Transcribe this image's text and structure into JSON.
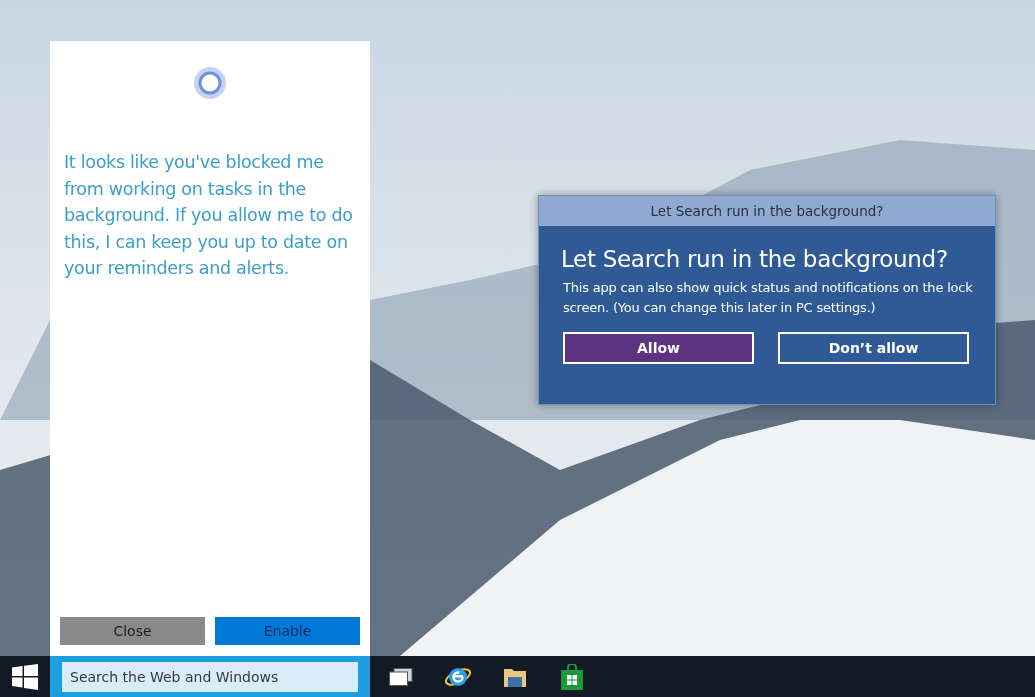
{
  "cortana": {
    "message": "It looks like you've blocked me from working on tasks in the background. If you allow me to do this, I can keep you up to date on your reminders and alerts.",
    "buttons": [
      {
        "label": "Close",
        "kind": "secondary"
      },
      {
        "label": "Enable",
        "kind": "primary"
      }
    ]
  },
  "dialog": {
    "title": "Let Search run in the background?",
    "heading": "Let Search run in the background?",
    "body": "This app can also show quick status and notifications on the lock screen. (You can change this later in PC settings.)",
    "buttons": [
      {
        "label": "Allow",
        "kind": "primary"
      },
      {
        "label": "Don’t allow",
        "kind": "secondary"
      }
    ]
  },
  "taskbar": {
    "search": {
      "placeholder": "Search the Web and Windows"
    }
  }
}
